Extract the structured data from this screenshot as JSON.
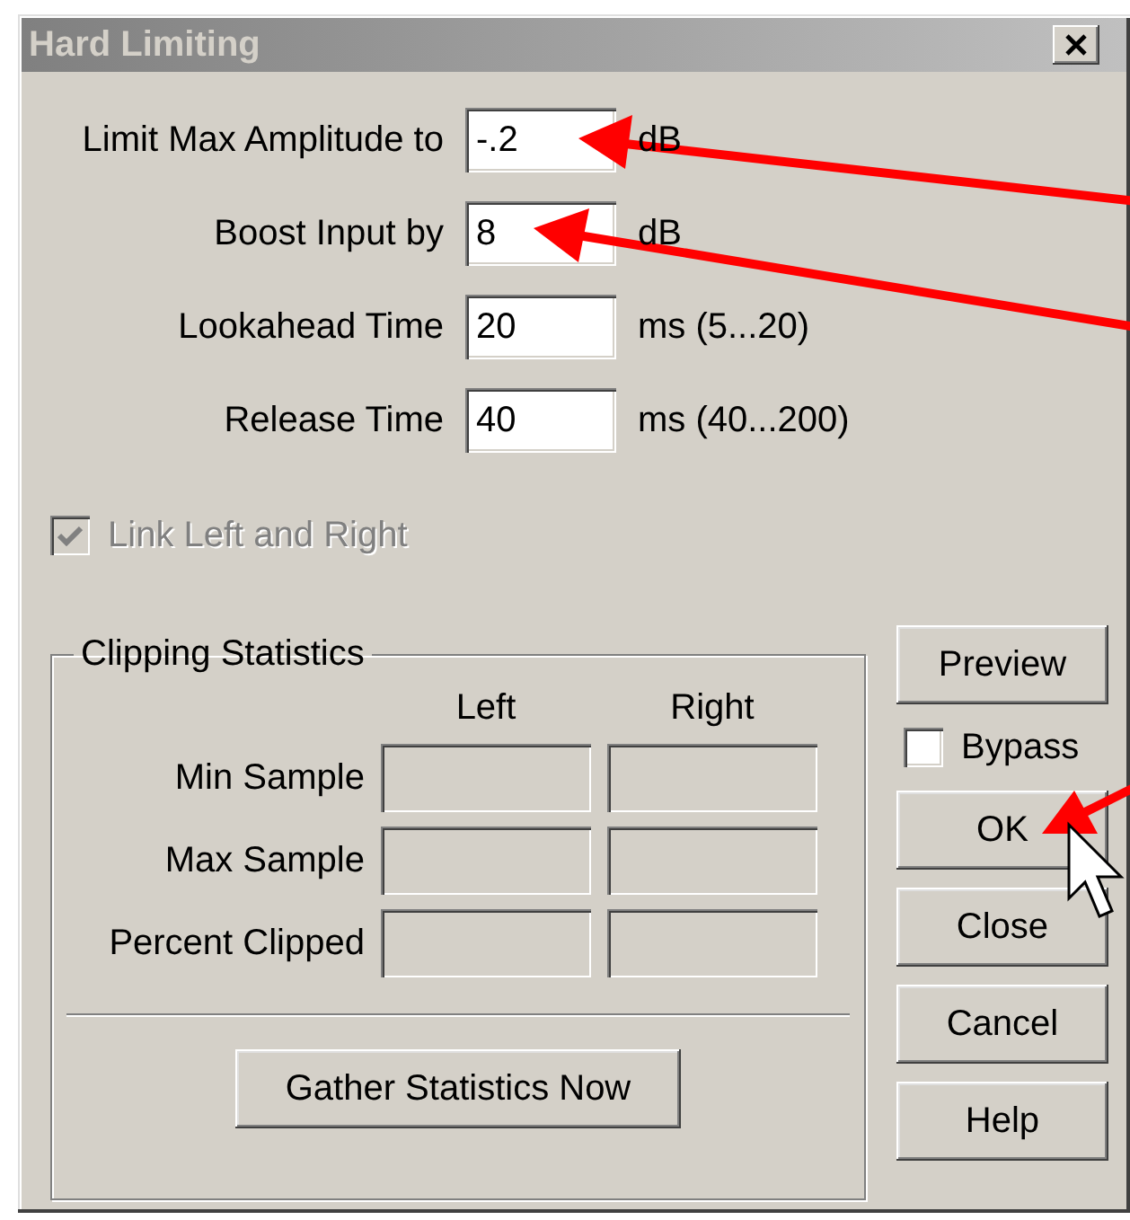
{
  "window": {
    "title": "Hard Limiting"
  },
  "fields": [
    {
      "label": "Limit Max Amplitude to",
      "value": "-.2",
      "unit": "dB"
    },
    {
      "label": "Boost Input by",
      "value": "8",
      "unit": "dB"
    },
    {
      "label": "Lookahead Time",
      "value": "20",
      "unit": "ms (5...20)"
    },
    {
      "label": "Release Time",
      "value": "40",
      "unit": "ms (40...200)"
    }
  ],
  "link_checkbox": {
    "label": "Link Left and Right",
    "checked": true,
    "disabled": true
  },
  "statistics": {
    "title": "Clipping Statistics",
    "columns": [
      "Left",
      "Right"
    ],
    "rows": [
      "Min Sample",
      "Max Sample",
      "Percent Clipped"
    ],
    "button": "Gather Statistics Now"
  },
  "side": [
    {
      "kind": "button",
      "label": "Preview"
    },
    {
      "kind": "checkbox",
      "label": "Bypass",
      "checked": false
    },
    {
      "kind": "button",
      "label": "OK"
    },
    {
      "kind": "button",
      "label": "Close"
    },
    {
      "kind": "button",
      "label": "Cancel"
    },
    {
      "kind": "button",
      "label": "Help"
    }
  ]
}
